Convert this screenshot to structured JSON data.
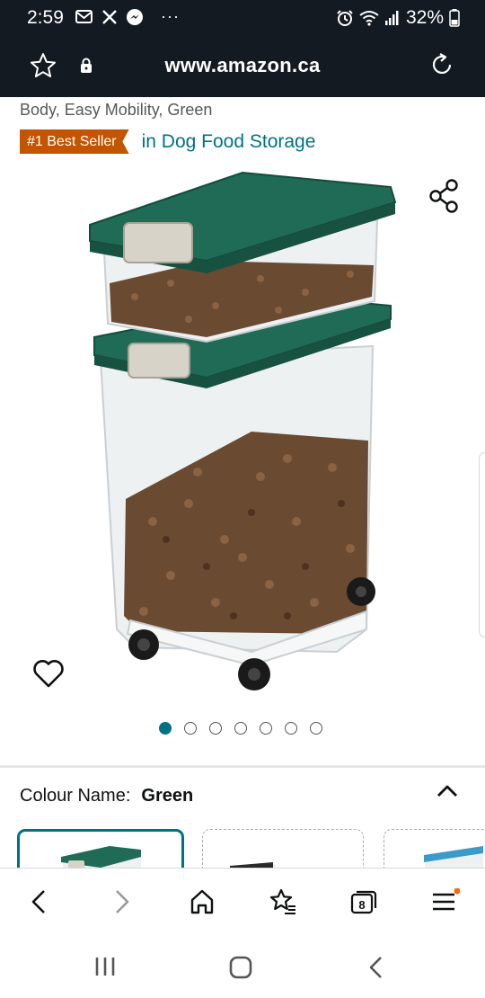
{
  "status_bar": {
    "time": "2:59",
    "battery": "32%",
    "notification_icons": [
      "mail-icon",
      "x-icon",
      "messenger-icon",
      "more-icon"
    ],
    "system_icons": [
      "alarm-icon",
      "wifi-icon",
      "signal-icon",
      "battery-icon"
    ]
  },
  "browser": {
    "url": "www.amazon.ca",
    "tabs_count": "8"
  },
  "product": {
    "title_tail": "Body, Easy Mobility, Green",
    "badge": "#1 Best Seller",
    "badge_category": "in Dog Food Storage",
    "image_count": 7,
    "active_image": 0
  },
  "variation": {
    "label": "Colour Name:",
    "value": "Green",
    "swatches": [
      "Green",
      "Black",
      "Blue"
    ]
  },
  "colors": {
    "status_bg": "#131a22",
    "accent_teal": "#007185",
    "badge_orange": "#c45500",
    "lid_green": "#1f6b55"
  }
}
